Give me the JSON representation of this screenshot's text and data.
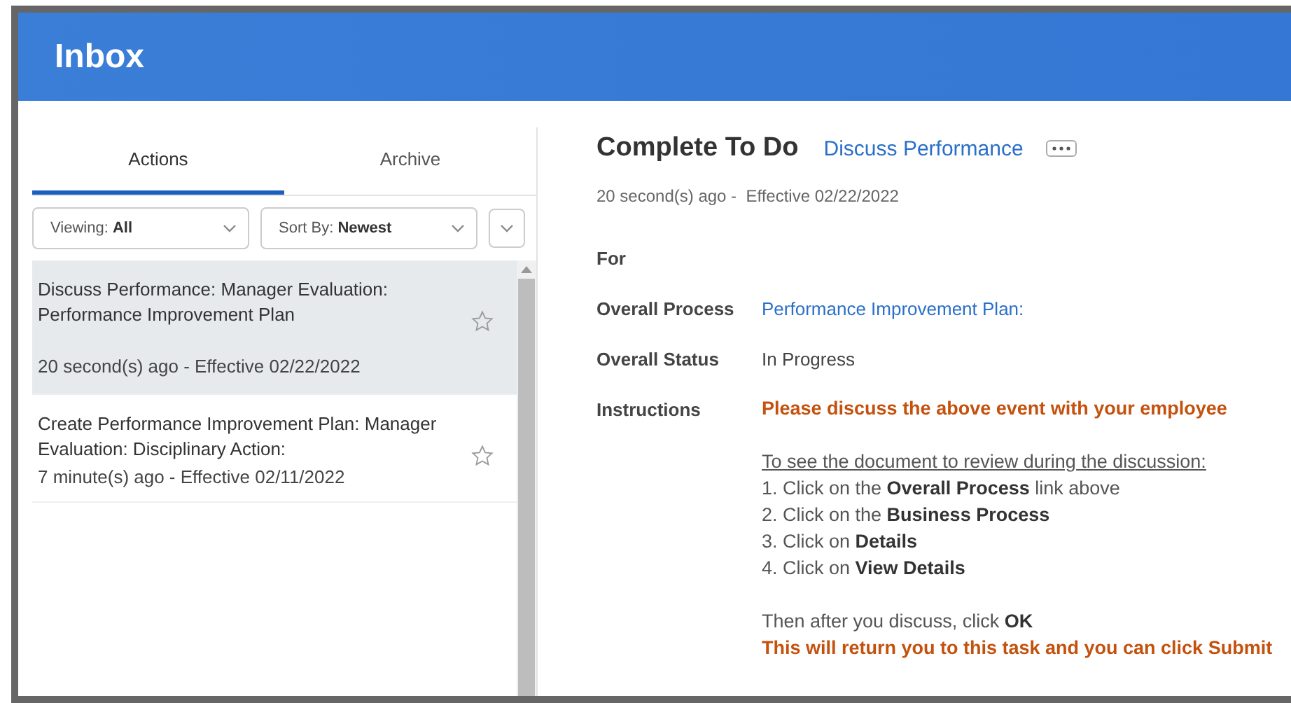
{
  "header": {
    "title": "Inbox"
  },
  "tabs": [
    {
      "label": "Actions",
      "selected": true
    },
    {
      "label": "Archive",
      "selected": false
    }
  ],
  "filters": [
    {
      "label": "Viewing:",
      "value": "All"
    },
    {
      "label": "Sort By:",
      "value": "Newest"
    }
  ],
  "items": [
    {
      "title": "Discuss Performance: Manager Evaluation: Performance Improvement Plan",
      "meta": "20 second(s) ago - Effective 02/22/2022",
      "selected": true,
      "starred": false
    },
    {
      "title": "Create Performance Improvement Plan: Manager Evaluation: Disciplinary Action:",
      "meta": "7 minute(s) ago - Effective 02/11/2022",
      "selected": false,
      "starred": false
    }
  ],
  "detail": {
    "title": "Complete To Do",
    "link": "Discuss Performance",
    "meta": "20 second(s) ago -  Effective 02/22/2022",
    "fields": [
      {
        "label": "For",
        "kind": "none"
      },
      {
        "label": "Overall Process",
        "kind": "link",
        "value": "Performance Improvement Plan:"
      },
      {
        "label": "Overall Status",
        "kind": "text",
        "value": "In Progress"
      }
    ],
    "instructions_label": "Instructions",
    "instructions": [
      [
        {
          "kind": "alert",
          "text": "Please discuss the above event with your employee"
        }
      ],
      [
        {
          "kind": "heading",
          "text": "To see the document to review during the discussion:"
        },
        {
          "kind": "plain",
          "text": "1. Click on the **Overall Process** link above"
        },
        {
          "kind": "plain",
          "text": "2. Click on the **Business Process**"
        },
        {
          "kind": "plain",
          "text": "3. Click on **Details**"
        },
        {
          "kind": "plain",
          "text": "4. Click on **View Details**"
        }
      ],
      [
        {
          "kind": "plain",
          "text": "Then after you discuss, click **OK**"
        },
        {
          "kind": "alert",
          "text": "This will return you to this task and you can click Submit"
        }
      ]
    ]
  }
}
